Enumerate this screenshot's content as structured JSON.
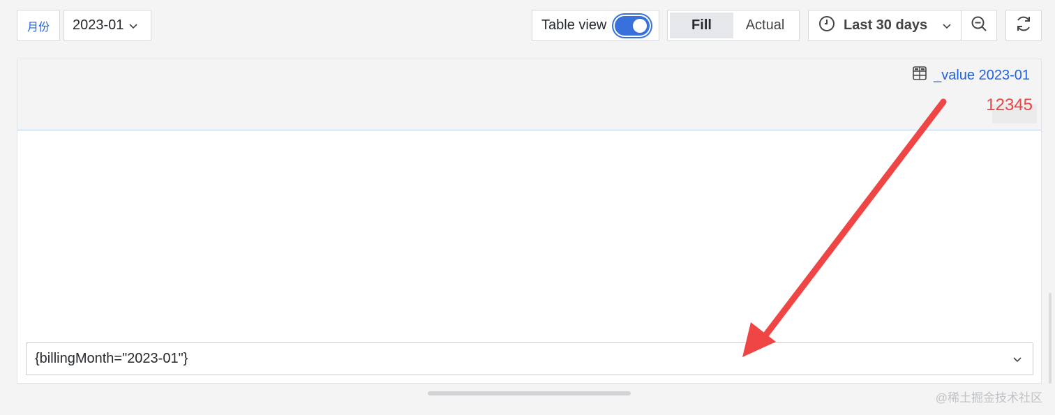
{
  "toolbar": {
    "variable_label": "月份",
    "variable_value": "2023-01",
    "table_view_label": "Table view",
    "table_view_enabled": true,
    "fill_label": "Fill",
    "actual_label": "Actual",
    "time_range": "Last 30 days"
  },
  "panel": {
    "column_header": "_value 2023-01",
    "cell_value": "12345",
    "series_selector": "{billingMonth=\"2023-01\"}"
  },
  "watermark": "@稀土掘金技术社区",
  "colors": {
    "accent": "#3871dc",
    "link": "#1f62e0",
    "value_red": "#e54545",
    "annotation_arrow": "#f04545"
  },
  "icons": {
    "dropdown": "chevron-down-icon",
    "time": "clock-icon",
    "zoom": "zoom-out-icon",
    "refresh": "refresh-icon",
    "column": "table-grid-icon"
  }
}
